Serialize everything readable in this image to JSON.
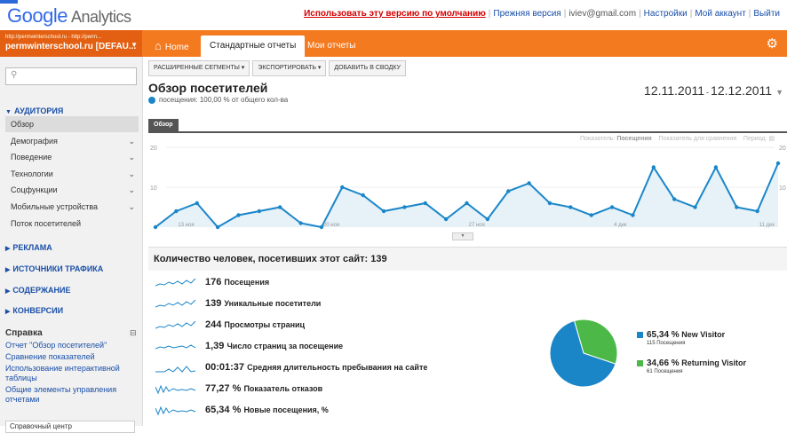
{
  "app": {
    "logo_google": "Google",
    "logo_product": "Analytics"
  },
  "toplinks": {
    "use_default": "Использовать эту версию по умолчанию",
    "old_version": "Прежняя версия",
    "email": "iviev@gmail.com",
    "settings": "Настройки",
    "account": "Мой аккаунт",
    "logout": "Выйти"
  },
  "account": {
    "url_line": "http://permwinterschool.ru - http://perm...",
    "name": "permwinterschool.ru [DEFAU..."
  },
  "nav": {
    "home": "Home",
    "standard": "Стандартные отчеты",
    "my_reports": "Мои отчеты"
  },
  "sidebar": {
    "audience": "АУДИТОРИЯ",
    "items": [
      {
        "label": "Обзор",
        "chevron": false
      },
      {
        "label": "Демография",
        "chevron": true
      },
      {
        "label": "Поведение",
        "chevron": true
      },
      {
        "label": "Технологии",
        "chevron": true
      },
      {
        "label": "Соцфункции",
        "chevron": true
      },
      {
        "label": "Мобильные устройства",
        "chevron": true
      },
      {
        "label": "Поток посетителей",
        "chevron": false
      }
    ],
    "sections": [
      "РЕКЛАМА",
      "ИСТОЧНИКИ ТРАФИКА",
      "СОДЕРЖАНИЕ",
      "КОНВЕРСИИ"
    ],
    "help_title": "Справка",
    "help_links": [
      "Отчет \"Обзор посетителей\"",
      "Сравнение показателей",
      "Использование интерактивной таблицы",
      "Общие элементы управления отчетами"
    ],
    "help_center": "Справочный центр"
  },
  "toolbar": {
    "segments": "РАСШИРЕННЫЕ СЕГМЕНТЫ ▾",
    "export": "ЭКСПОРТИРОВАТЬ ▾",
    "add": "ДОБАВИТЬ В СВОДКУ"
  },
  "report": {
    "title": "Обзор посетителей",
    "subtitle": "посещения: 100,00 % от общего кол-ва",
    "date_from": "12.11.2011",
    "date_sep": "-",
    "date_to": "12.12.2011",
    "tab": "Обзор",
    "show_label": "Показатель:",
    "show_value": "Посещения",
    "compare": "Показатель для сравнения",
    "period": "Период:"
  },
  "chart_data": {
    "type": "line",
    "ylim": [
      0,
      20
    ],
    "yticks_left": [
      "20",
      "10"
    ],
    "yticks_right": [
      "20",
      "10"
    ],
    "x_labels": [
      "13 ноя",
      "20 ноя",
      "27 ноя",
      "4 дек",
      "11 дек"
    ],
    "series": [
      {
        "values": [
          0,
          4,
          6,
          0,
          3,
          4,
          5,
          1,
          0,
          10,
          8,
          4,
          5,
          6,
          2,
          6,
          2,
          9,
          11,
          6,
          5,
          3,
          5,
          3,
          15,
          7,
          5,
          15,
          5,
          4,
          16
        ]
      }
    ],
    "colors": {
      "line": "#1a86c8",
      "fill": "#e6f1f8"
    }
  },
  "people": {
    "text": "Количество человек, посетивших этот сайт: 139"
  },
  "metrics": [
    {
      "value": "176",
      "label": "Посещения"
    },
    {
      "value": "139",
      "label": "Уникальные посетители"
    },
    {
      "value": "244",
      "label": "Просмотры страниц"
    },
    {
      "value": "1,39",
      "label": "Число страниц за посещение"
    },
    {
      "value": "00:01:37",
      "label": "Средняя длительность пребывания на сайте"
    },
    {
      "value": "77,27 %",
      "label": "Показатель отказов"
    },
    {
      "value": "65,34 %",
      "label": "Новые посещения, %"
    }
  ],
  "pie": {
    "slices": [
      {
        "pct": "65,34 %",
        "value": 65.34,
        "name": "New Visitor",
        "sub": "115 Посещения",
        "color": "#1a86c8"
      },
      {
        "pct": "34,66 %",
        "value": 34.66,
        "name": "Returning Visitor",
        "sub": "61 Посещения",
        "color": "#4cb847"
      }
    ]
  }
}
